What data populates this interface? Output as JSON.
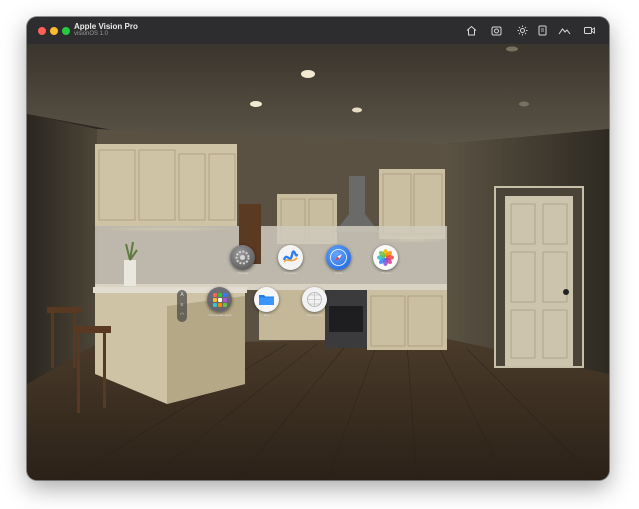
{
  "window": {
    "title": "Apple Vision Pro",
    "subtitle": "visionOS 1.0"
  },
  "toolbar": {
    "icons": [
      "home-icon",
      "screenshot-icon",
      "brightness-icon",
      "device-icon",
      "environment-icon",
      "record-icon"
    ]
  },
  "apps": [
    {
      "label": "Settings",
      "icon": "settings-icon"
    },
    {
      "label": "Freeform",
      "icon": "freeform-icon"
    },
    {
      "label": "Safari",
      "icon": "safari-icon"
    },
    {
      "label": "Photos",
      "icon": "photos-icon"
    },
    {
      "label": "Compatible Apps",
      "icon": "compatible-apps-icon"
    },
    {
      "label": "Files",
      "icon": "files-icon"
    },
    {
      "label": "Experience",
      "icon": "experience-icon"
    }
  ],
  "bottom_controls": [
    "interact-icon",
    "tilt-icon",
    "pan-icon",
    "orbit-icon",
    "zoom-icon"
  ],
  "colors": {
    "titlebar": "#2d2d2f",
    "close": "#ff5f57",
    "minimize": "#febc2e",
    "maximize": "#28c840",
    "accent": "#2f7df6"
  }
}
